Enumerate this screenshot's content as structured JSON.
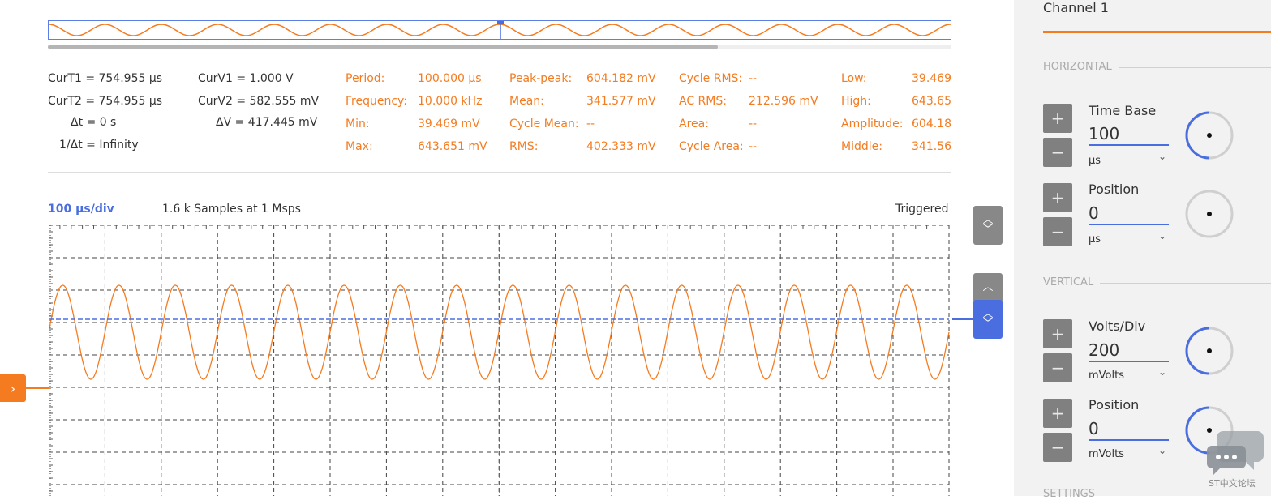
{
  "overview": {
    "name": "overview-waveform"
  },
  "cursors": {
    "curT1": "CurT1 = 754.955 μs",
    "curT2": "CurT2 = 754.955 μs",
    "dt": "Δt = 0 s",
    "inv_dt": "1/Δt = Infinity",
    "curV1": "CurV1 = 1.000 V",
    "curV2": "CurV2 = 582.555 mV",
    "dv": "ΔV =  417.445 mV"
  },
  "measurements": {
    "col1": [
      {
        "label": "Period:",
        "value": "100.000 μs"
      },
      {
        "label": "Frequency:",
        "value": "10.000 kHz"
      },
      {
        "label": "Min:",
        "value": "39.469 mV"
      },
      {
        "label": "Max:",
        "value": "643.651 mV"
      }
    ],
    "col2": [
      {
        "label": "Peak-peak:",
        "value": "604.182 mV"
      },
      {
        "label": "Mean:",
        "value": "341.577 mV"
      },
      {
        "label": "Cycle Mean:",
        "value": "--"
      },
      {
        "label": "RMS:",
        "value": "402.333 mV"
      }
    ],
    "col3": [
      {
        "label": "Cycle RMS:",
        "value": "--"
      },
      {
        "label": "AC RMS:",
        "value": "212.596 mV"
      },
      {
        "label": "Area:",
        "value": "--"
      },
      {
        "label": "Cycle Area:",
        "value": "--"
      }
    ],
    "col4": [
      {
        "label": "Low:",
        "value": "39.469"
      },
      {
        "label": "High:",
        "value": "643.65"
      },
      {
        "label": "Amplitude:",
        "value": "604.18"
      },
      {
        "label": "Middle:",
        "value": "341.56"
      }
    ]
  },
  "scope": {
    "time_per_div": "100 μs/div",
    "samples": "1.6 k Samples at 1 Msps",
    "status": "Triggered",
    "waveform_cycles": 16,
    "waveform_color": "#f47b20",
    "cursor_color": "#4a6ee0"
  },
  "panel": {
    "title": "Channel 1",
    "horizontal_label": "HORIZONTAL",
    "vertical_label": "VERTICAL",
    "settings_label": "SETTINGS",
    "time_base": {
      "label": "Time Base",
      "value": "100",
      "unit": "μs",
      "knob_level": 0.5
    },
    "h_position": {
      "label": "Position",
      "value": "0",
      "unit": "μs",
      "knob_level": 0.0
    },
    "volts_div": {
      "label": "Volts/Div",
      "value": "200",
      "unit": "mVolts",
      "knob_level": 0.5
    },
    "v_position": {
      "label": "Position",
      "value": "0",
      "unit": "mVolts",
      "knob_level": 0.5
    },
    "plus": "+",
    "minus": "−",
    "caret": "⌄"
  },
  "chat": {
    "label": "ST中文论坛"
  },
  "colors": {
    "accent_orange": "#f47b20",
    "accent_blue": "#4a6ee0",
    "panel_bg": "#f2f2f2"
  }
}
